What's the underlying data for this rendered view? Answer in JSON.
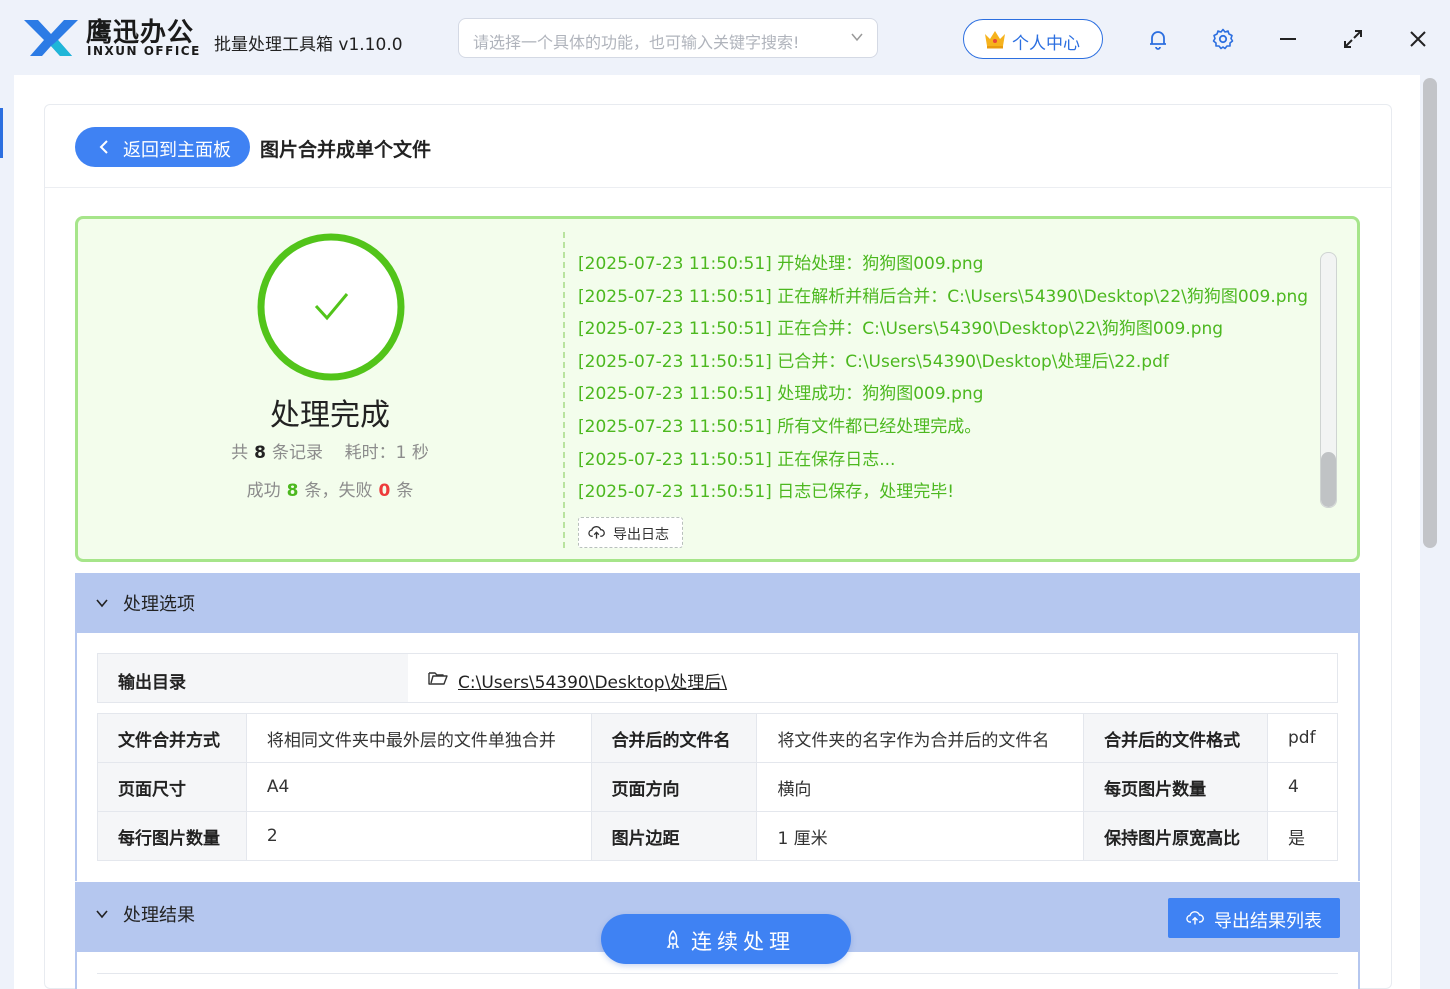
{
  "app": {
    "brand_cn": "鹰迅办公",
    "brand_en": "INXUN OFFICE",
    "title": "批量处理工具箱 v1.10.0",
    "search_placeholder": "请选择一个具体的功能，也可输入关键字搜索!",
    "user_center": "个人中心"
  },
  "header": {
    "back_label": "返回到主面板",
    "page_title": "图片合并成单个文件"
  },
  "status": {
    "done_text": "处理完成",
    "total_prefix": "共",
    "total_count": "8",
    "total_suffix": "条记录",
    "time_label": "耗时：1 秒",
    "success_prefix": "成功",
    "success_count": "8",
    "success_suffix": "条，失败",
    "fail_count": "0",
    "fail_suffix": "条"
  },
  "log": {
    "lines": [
      "[2025-07-23 11:50:51] 开始处理：狗狗图009.png",
      "[2025-07-23 11:50:51] 正在解析并稍后合并：C:\\Users\\54390\\Desktop\\22\\狗狗图009.png",
      "[2025-07-23 11:50:51] 正在合并：C:\\Users\\54390\\Desktop\\22\\狗狗图009.png",
      "[2025-07-23 11:50:51] 已合并：C:\\Users\\54390\\Desktop\\处理后\\22.pdf",
      "[2025-07-23 11:50:51] 处理成功：狗狗图009.png",
      "[2025-07-23 11:50:51] 所有文件都已经处理完成。",
      "[2025-07-23 11:50:51] 正在保存日志...",
      "[2025-07-23 11:50:51] 日志已保存，处理完毕!"
    ],
    "export_label": "导出日志"
  },
  "options": {
    "section_label": "处理选项",
    "output_dir_label": "输出目录",
    "output_dir_value": "C:\\Users\\54390\\Desktop\\处理后\\",
    "rows": [
      [
        {
          "k": "文件合并方式",
          "v": "将相同文件夹中最外层的文件单独合并"
        },
        {
          "k": "合并后的文件名",
          "v": "将文件夹的名字作为合并后的文件名"
        },
        {
          "k": "合并后的文件格式",
          "v": "pdf"
        }
      ],
      [
        {
          "k": "页面尺寸",
          "v": "A4"
        },
        {
          "k": "页面方向",
          "v": "横向"
        },
        {
          "k": "每页图片数量",
          "v": "4"
        }
      ],
      [
        {
          "k": "每行图片数量",
          "v": "2"
        },
        {
          "k": "图片边距",
          "v": "1 厘米"
        },
        {
          "k": "保持图片原宽高比",
          "v": "是"
        }
      ]
    ]
  },
  "results": {
    "section_label": "处理结果",
    "export_label": "导出结果列表",
    "continue_label": "连续处理"
  },
  "colors": {
    "primary": "#3f82f3",
    "success": "#4cb81f",
    "fail": "#ee3b3b",
    "section_header": "#b5c7ef"
  }
}
